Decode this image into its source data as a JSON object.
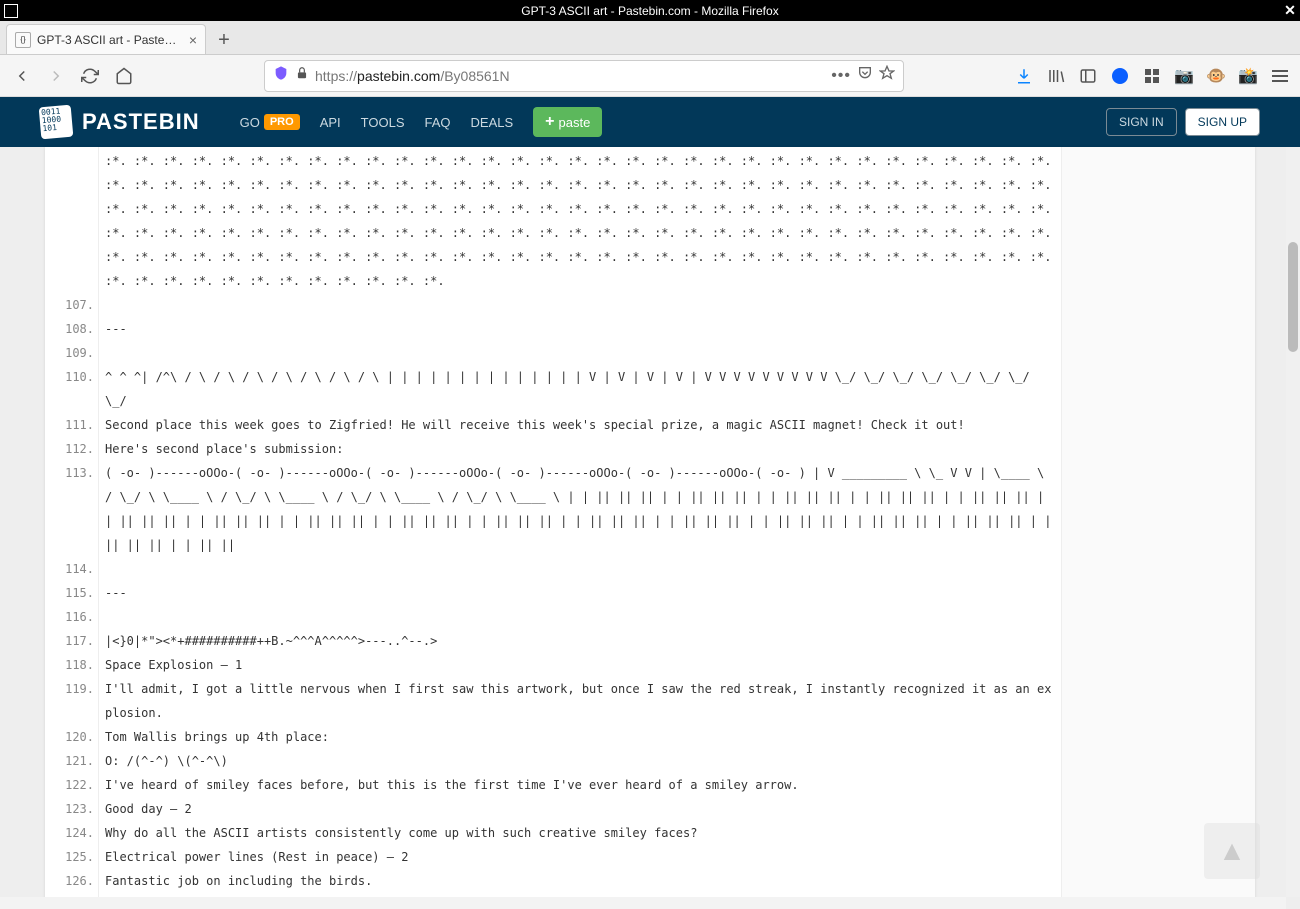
{
  "window": {
    "title": "GPT-3 ASCII art - Pastebin.com - Mozilla Firefox"
  },
  "tab": {
    "title": "GPT-3 ASCII art - Pastebin..."
  },
  "url": {
    "protocol": "https://",
    "domain": "pastebin.com",
    "path": "/By08561N"
  },
  "pastebin": {
    "brand": "PASTEBIN",
    "logo_text": "0011\n1000\n101",
    "nav": {
      "go": "GO",
      "pro": "PRO",
      "api": "API",
      "tools": "TOOLS",
      "faq": "FAQ",
      "deals": "DEALS"
    },
    "paste_btn": "paste",
    "signin": "SIGN IN",
    "signup": "SIGN UP"
  },
  "lines": [
    {
      "n": "",
      "t": ":*. :*. :*. :*. :*. :*. :*. :*. :*. :*. :*. :*. :*. :*. :*. :*. :*. :*. :*. :*. :*. :*. :*. :*. :*. :*. :*. :*. :*. :*. :*. :*. :*. :*. :*. :*. :*. :*. :*. :*. :*. :*. :*. :*. :*. :*. :*. :*. :*. :*. :*. :*. :*. :*. :*. :*. :*. :*. :*. :*. :*. :*. :*. :*. :*. :*. :*. :*. :*. :*. :*. :*. :*. :*. :*. :*. :*. :*. :*. :*. :*. :*. :*. :*. :*. :*. :*. :*. :*. :*. :*. :*. :*. :*. :*. :*. :*. :*. :*. :*. :*. :*. :*. :*. :*. :*. :*. :*. :*. :*. :*. :*. :*. :*. :*. :*. :*. :*. :*. :*. :*. :*. :*. :*. :*. :*. :*. :*. :*. :*. :*. :*. :*. :*. :*. :*. :*. :*. :*. :*. :*. :*. :*. :*. :*. :*. :*. :*. :*. :*. :*. :*. :*. :*. :*. :*. :*. :*. :*. :*. :*. :*. :*. :*. :*. :*. :*. :*. :*. :*. :*. :*. :*. :*. :*. :*. :*."
    },
    {
      "n": "107.",
      "t": " "
    },
    {
      "n": "108.",
      "t": "---"
    },
    {
      "n": "109.",
      "t": " "
    },
    {
      "n": "110.",
      "t": "^ ^ ^| /^\\ / \\ / \\ / \\ / \\ / \\ / \\ / \\ | | | | | | | | | | | | | | V | V | V | V | V V V V V V V V V \\_/ \\_/ \\_/ \\_/ \\_/ \\_/ \\_/ \\_/"
    },
    {
      "n": "111.",
      "t": "Second place this week goes to Zigfried! He will receive this week's special prize, a magic ASCII magnet! Check it out!"
    },
    {
      "n": "112.",
      "t": "Here's second place's submission:"
    },
    {
      "n": "113.",
      "t": "( -o- )------oOOo-( -o- )------oOOo-( -o- )------oOOo-( -o- )------oOOo-( -o- )------oOOo-( -o- ) | V _________ \\ \\_ V V | \\____ \\ / \\_/ \\ \\____ \\ / \\_/ \\ \\____ \\ / \\_/ \\ \\____ \\ / \\_/ \\ \\____ \\ | | || || || | | || || || | | || || || | | || || || | | || || || | | || || || | | || || || | | || || || | | || || || | | || || || | | || || || | | || || || | | || || || | | || || || | | || || || | | || || || | | || ||"
    },
    {
      "n": "114.",
      "t": " "
    },
    {
      "n": "115.",
      "t": "---"
    },
    {
      "n": "116.",
      "t": " "
    },
    {
      "n": "117.",
      "t": "|<}0|*\"><*+##########++B.~^^^A^^^^^>---..^--.>"
    },
    {
      "n": "118.",
      "t": "Space Explosion – 1"
    },
    {
      "n": "119.",
      "t": "I'll admit, I got a little nervous when I first saw this artwork, but once I saw the red streak, I instantly recognized it as an explosion."
    },
    {
      "n": "120.",
      "t": "Tom Wallis brings up 4th place:"
    },
    {
      "n": "121.",
      "t": "O: /(^-^) \\(^-^\\)"
    },
    {
      "n": "122.",
      "t": "I've heard of smiley faces before, but this is the first time I've ever heard of a smiley arrow."
    },
    {
      "n": "123.",
      "t": "Good day – 2"
    },
    {
      "n": "124.",
      "t": "Why do all the ASCII artists consistently come up with such creative smiley faces?"
    },
    {
      "n": "125.",
      "t": "Electrical power lines (Rest in peace) – 2"
    },
    {
      "n": "126.",
      "t": "Fantastic job on including the birds."
    }
  ]
}
